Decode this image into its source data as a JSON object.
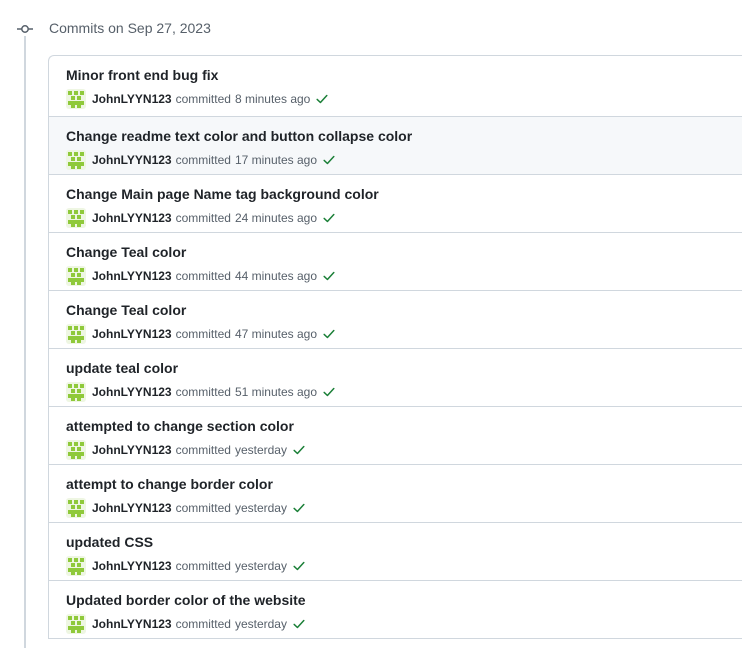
{
  "group": {
    "title": "Commits on Sep 27, 2023"
  },
  "commits": [
    {
      "title": "Minor front end bug fix",
      "author": "JohnLYYN123",
      "verb": "committed",
      "time": "8 minutes ago",
      "status_icon": "check-icon"
    },
    {
      "title": "Change readme text color and button collapse color",
      "author": "JohnLYYN123",
      "verb": "committed",
      "time": "17 minutes ago",
      "status_icon": "check-icon"
    },
    {
      "title": "Change Main page Name tag background color",
      "author": "JohnLYYN123",
      "verb": "committed",
      "time": "24 minutes ago",
      "status_icon": "check-icon"
    },
    {
      "title": "Change Teal color",
      "author": "JohnLYYN123",
      "verb": "committed",
      "time": "44 minutes ago",
      "status_icon": "check-icon"
    },
    {
      "title": "Change Teal color",
      "author": "JohnLYYN123",
      "verb": "committed",
      "time": "47 minutes ago",
      "status_icon": "check-icon"
    },
    {
      "title": "update teal color",
      "author": "JohnLYYN123",
      "verb": "committed",
      "time": "51 minutes ago",
      "status_icon": "check-icon"
    },
    {
      "title": "attempted to change section color",
      "author": "JohnLYYN123",
      "verb": "committed",
      "time": "yesterday",
      "status_icon": "check-icon"
    },
    {
      "title": "attempt to change border color",
      "author": "JohnLYYN123",
      "verb": "committed",
      "time": "yesterday",
      "status_icon": "check-icon"
    },
    {
      "title": "updated CSS",
      "author": "JohnLYYN123",
      "verb": "committed",
      "time": "yesterday",
      "status_icon": "check-icon"
    },
    {
      "title": "Updated border color of the website",
      "author": "JohnLYYN123",
      "verb": "committed",
      "time": "yesterday",
      "status_icon": "check-icon"
    }
  ],
  "colors": {
    "check_green": "#1a7f37",
    "avatar_green": "#8fc93a",
    "border": "#d0d7de",
    "hover_bg": "#f6f8fa",
    "muted_text": "#57606a"
  }
}
